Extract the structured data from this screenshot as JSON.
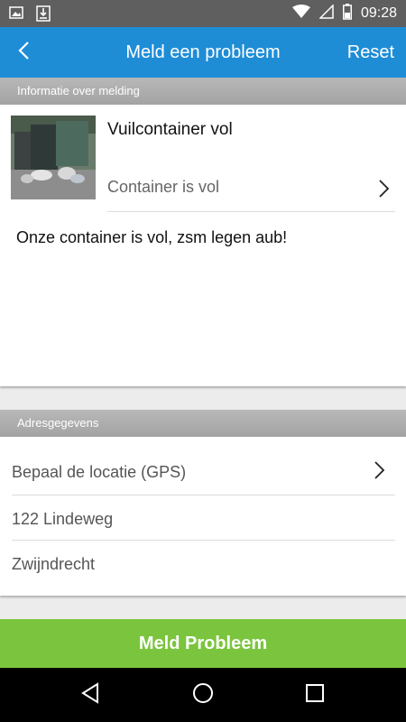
{
  "status_bar": {
    "time": "09:28",
    "icons": [
      "image-icon",
      "download-icon",
      "wifi-icon",
      "signal-icon",
      "battery-icon"
    ]
  },
  "app_bar": {
    "title": "Meld een probleem",
    "reset_label": "Reset",
    "back_icon": "back-arrow-icon",
    "color": "#1f8dd6"
  },
  "info_section": {
    "header": "Informatie over melding",
    "category_title": "Vuilcontainer vol",
    "category_subtitle": "Container is vol",
    "description": "Onze container is vol, zsm legen aub!"
  },
  "address_section": {
    "header": "Adresgegevens",
    "gps_label": "Bepaal de locatie (GPS)",
    "street": "122 Lindeweg",
    "city": "Zwijndrecht"
  },
  "submit": {
    "label": "Meld Probleem",
    "color": "#7ac53d"
  },
  "nav_bar": {
    "icons": [
      "back-triangle-icon",
      "home-circle-icon",
      "recents-square-icon"
    ]
  }
}
